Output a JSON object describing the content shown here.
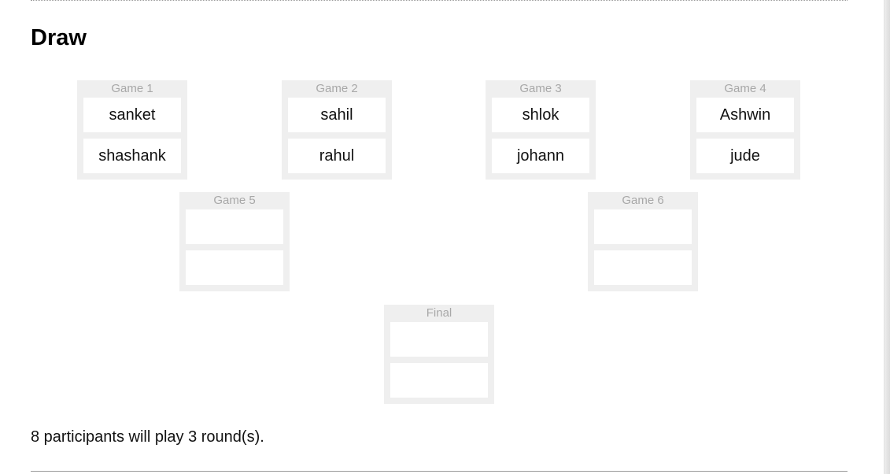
{
  "section": {
    "title": "Draw"
  },
  "bracket": {
    "games": [
      {
        "label": "Game 1",
        "players": [
          "sanket",
          "shashank"
        ]
      },
      {
        "label": "Game 2",
        "players": [
          "sahil",
          "rahul"
        ]
      },
      {
        "label": "Game 3",
        "players": [
          "shlok",
          "johann"
        ]
      },
      {
        "label": "Game 4",
        "players": [
          "Ashwin",
          "jude"
        ]
      },
      {
        "label": "Game 5",
        "players": [
          "",
          ""
        ]
      },
      {
        "label": "Game 6",
        "players": [
          "",
          ""
        ]
      },
      {
        "label": "Final",
        "players": [
          "",
          ""
        ]
      }
    ]
  },
  "summary": {
    "text": "8 participants will play 3 round(s)."
  },
  "colors": {
    "game_background": "#efefef",
    "game_label": "#a8a8a8",
    "slot_background": "#ffffff"
  }
}
